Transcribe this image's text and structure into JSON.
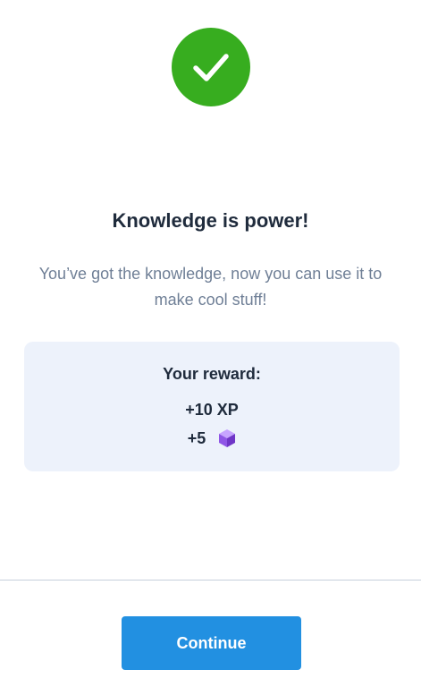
{
  "header": {
    "icon": "check-circle-icon",
    "icon_color": "#37ad1f"
  },
  "content": {
    "title": "Knowledge is power!",
    "subtitle": "You’ve got the knowledge, now you can use it to make cool stuff!"
  },
  "reward": {
    "title": "Your reward:",
    "xp": "+10 XP",
    "gems": "+5",
    "gem_icon": "purple-gem-icon",
    "card_color": "#edf2fb"
  },
  "footer": {
    "continue_label": "Continue",
    "button_color": "#2290e1"
  }
}
